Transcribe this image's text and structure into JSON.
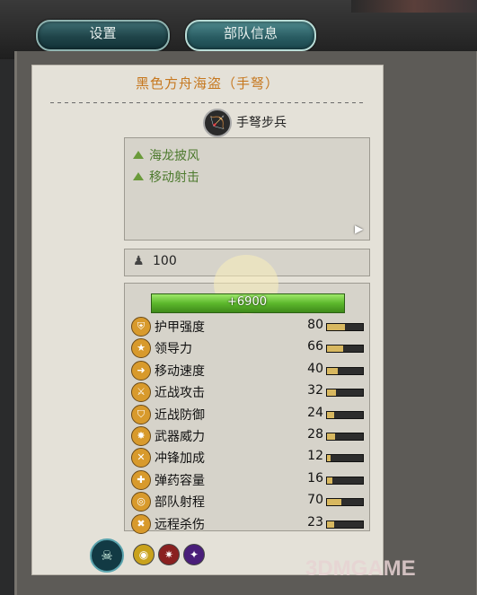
{
  "tabs": {
    "settings": "设置",
    "unit_info": "部队信息"
  },
  "unit": {
    "name": "黑色方舟海盗（手弩）",
    "type_icon": "crossbow-icon",
    "type": "手弩步兵",
    "abilities": [
      "海龙披风",
      "移动射击"
    ],
    "men": "100",
    "hp": "6900",
    "hp_fill": 1.0
  },
  "stats": [
    {
      "name": "护甲强度",
      "value": "80",
      "fill": 0.5,
      "icon": "armor-icon"
    },
    {
      "name": "领导力",
      "value": "66",
      "fill": 0.45,
      "icon": "leadership-icon"
    },
    {
      "name": "移动速度",
      "value": "40",
      "fill": 0.3,
      "icon": "speed-icon"
    },
    {
      "name": "近战攻击",
      "value": "32",
      "fill": 0.25,
      "icon": "melee-attack-icon"
    },
    {
      "name": "近战防御",
      "value": "24",
      "fill": 0.2,
      "icon": "melee-defense-icon"
    },
    {
      "name": "武器威力",
      "value": "28",
      "fill": 0.22,
      "icon": "weapon-strength-icon"
    },
    {
      "name": "冲锋加成",
      "value": "12",
      "fill": 0.1,
      "icon": "charge-bonus-icon"
    },
    {
      "name": "弹药容量",
      "value": "16",
      "fill": 0.15,
      "icon": "ammunition-icon"
    },
    {
      "name": "部队射程",
      "value": "70",
      "fill": 0.4,
      "icon": "range-icon"
    },
    {
      "name": "远程杀伤",
      "value": "23",
      "fill": 0.2,
      "icon": "missile-damage-icon"
    }
  ],
  "watermark": "3DMGAME"
}
